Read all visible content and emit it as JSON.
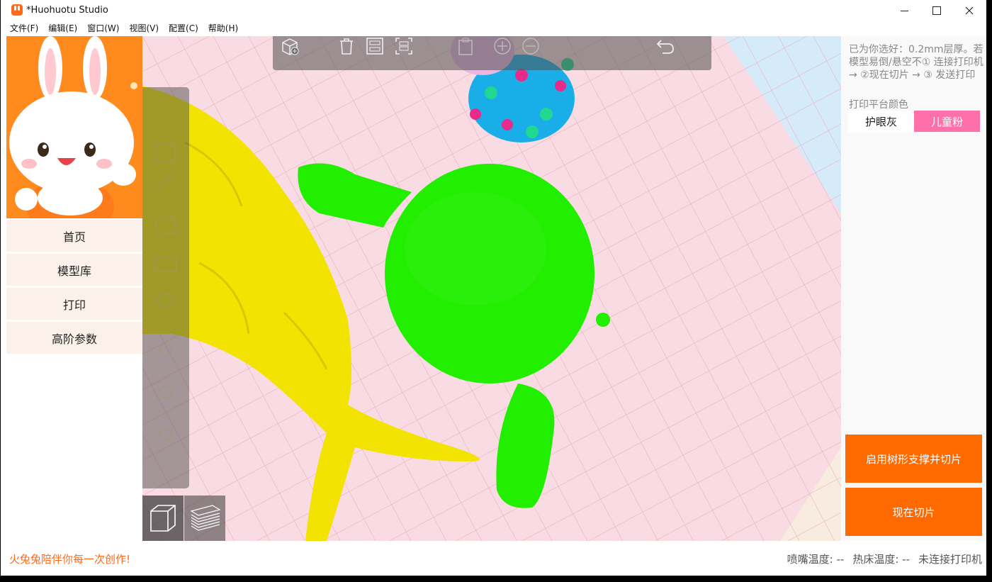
{
  "window": {
    "title": "*Huohuotu Studio"
  },
  "menu": [
    {
      "label": "文件(F)"
    },
    {
      "label": "编辑(E)"
    },
    {
      "label": "窗口(W)"
    },
    {
      "label": "视图(V)"
    },
    {
      "label": "配置(C)"
    },
    {
      "label": "帮助(H)"
    }
  ],
  "sidebar": {
    "items": [
      {
        "label": "首页"
      },
      {
        "label": "模型库"
      },
      {
        "label": "打印"
      },
      {
        "label": "高阶参数"
      }
    ]
  },
  "toolbar": {
    "icons": [
      "add-model-icon",
      "delete-icon",
      "arrange-icon",
      "auto-layout-icon",
      "paste-icon",
      "zoom-in-icon",
      "zoom-out-icon",
      "undo-icon"
    ]
  },
  "view_tabs": [
    "3d-view-icon",
    "layer-view-icon"
  ],
  "right_panel": {
    "hint": "已为你选好：0.2mm层厚。若模型易倒/悬空不① 连接打印机 → ②现在切片 → ③ 发送打印",
    "color_label": "打印平台颜色",
    "color_options": [
      {
        "label": "护眼灰",
        "selected": false
      },
      {
        "label": "儿童粉",
        "selected": true
      }
    ],
    "tree_support_button": "启用树形支撑并切片",
    "slice_button": "现在切片"
  },
  "status": {
    "slogan": "火兔兔陪伴你每一次创作!",
    "nozzle": "喷嘴温度: --",
    "bed": "热床温度: --",
    "printer": "未连接打印机"
  },
  "colors": {
    "accent": "#ff6a00",
    "pink_platform": "#f9dbe3",
    "pink_button": "#ff6fa9",
    "sidebar_item": "#fbf1ea",
    "model_green": "#22ee00",
    "model_yellow": "#f2e400"
  }
}
